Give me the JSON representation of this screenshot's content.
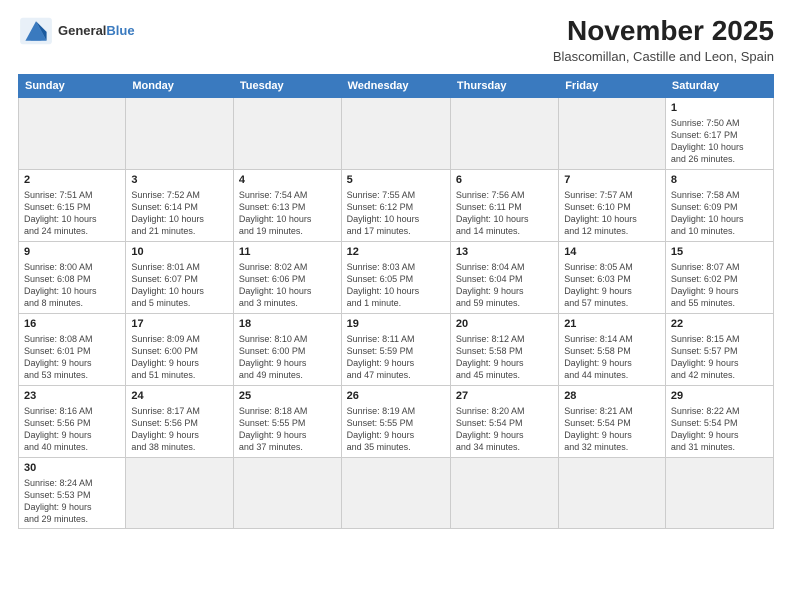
{
  "header": {
    "logo_general": "General",
    "logo_blue": "Blue",
    "month_title": "November 2025",
    "location": "Blascomillan, Castille and Leon, Spain"
  },
  "days_of_week": [
    "Sunday",
    "Monday",
    "Tuesday",
    "Wednesday",
    "Thursday",
    "Friday",
    "Saturday"
  ],
  "weeks": [
    [
      {
        "day": "",
        "info": ""
      },
      {
        "day": "",
        "info": ""
      },
      {
        "day": "",
        "info": ""
      },
      {
        "day": "",
        "info": ""
      },
      {
        "day": "",
        "info": ""
      },
      {
        "day": "",
        "info": ""
      },
      {
        "day": "1",
        "info": "Sunrise: 7:50 AM\nSunset: 6:17 PM\nDaylight: 10 hours\nand 26 minutes."
      }
    ],
    [
      {
        "day": "2",
        "info": "Sunrise: 7:51 AM\nSunset: 6:15 PM\nDaylight: 10 hours\nand 24 minutes."
      },
      {
        "day": "3",
        "info": "Sunrise: 7:52 AM\nSunset: 6:14 PM\nDaylight: 10 hours\nand 21 minutes."
      },
      {
        "day": "4",
        "info": "Sunrise: 7:54 AM\nSunset: 6:13 PM\nDaylight: 10 hours\nand 19 minutes."
      },
      {
        "day": "5",
        "info": "Sunrise: 7:55 AM\nSunset: 6:12 PM\nDaylight: 10 hours\nand 17 minutes."
      },
      {
        "day": "6",
        "info": "Sunrise: 7:56 AM\nSunset: 6:11 PM\nDaylight: 10 hours\nand 14 minutes."
      },
      {
        "day": "7",
        "info": "Sunrise: 7:57 AM\nSunset: 6:10 PM\nDaylight: 10 hours\nand 12 minutes."
      },
      {
        "day": "8",
        "info": "Sunrise: 7:58 AM\nSunset: 6:09 PM\nDaylight: 10 hours\nand 10 minutes."
      }
    ],
    [
      {
        "day": "9",
        "info": "Sunrise: 8:00 AM\nSunset: 6:08 PM\nDaylight: 10 hours\nand 8 minutes."
      },
      {
        "day": "10",
        "info": "Sunrise: 8:01 AM\nSunset: 6:07 PM\nDaylight: 10 hours\nand 5 minutes."
      },
      {
        "day": "11",
        "info": "Sunrise: 8:02 AM\nSunset: 6:06 PM\nDaylight: 10 hours\nand 3 minutes."
      },
      {
        "day": "12",
        "info": "Sunrise: 8:03 AM\nSunset: 6:05 PM\nDaylight: 10 hours\nand 1 minute."
      },
      {
        "day": "13",
        "info": "Sunrise: 8:04 AM\nSunset: 6:04 PM\nDaylight: 9 hours\nand 59 minutes."
      },
      {
        "day": "14",
        "info": "Sunrise: 8:05 AM\nSunset: 6:03 PM\nDaylight: 9 hours\nand 57 minutes."
      },
      {
        "day": "15",
        "info": "Sunrise: 8:07 AM\nSunset: 6:02 PM\nDaylight: 9 hours\nand 55 minutes."
      }
    ],
    [
      {
        "day": "16",
        "info": "Sunrise: 8:08 AM\nSunset: 6:01 PM\nDaylight: 9 hours\nand 53 minutes."
      },
      {
        "day": "17",
        "info": "Sunrise: 8:09 AM\nSunset: 6:00 PM\nDaylight: 9 hours\nand 51 minutes."
      },
      {
        "day": "18",
        "info": "Sunrise: 8:10 AM\nSunset: 6:00 PM\nDaylight: 9 hours\nand 49 minutes."
      },
      {
        "day": "19",
        "info": "Sunrise: 8:11 AM\nSunset: 5:59 PM\nDaylight: 9 hours\nand 47 minutes."
      },
      {
        "day": "20",
        "info": "Sunrise: 8:12 AM\nSunset: 5:58 PM\nDaylight: 9 hours\nand 45 minutes."
      },
      {
        "day": "21",
        "info": "Sunrise: 8:14 AM\nSunset: 5:58 PM\nDaylight: 9 hours\nand 44 minutes."
      },
      {
        "day": "22",
        "info": "Sunrise: 8:15 AM\nSunset: 5:57 PM\nDaylight: 9 hours\nand 42 minutes."
      }
    ],
    [
      {
        "day": "23",
        "info": "Sunrise: 8:16 AM\nSunset: 5:56 PM\nDaylight: 9 hours\nand 40 minutes."
      },
      {
        "day": "24",
        "info": "Sunrise: 8:17 AM\nSunset: 5:56 PM\nDaylight: 9 hours\nand 38 minutes."
      },
      {
        "day": "25",
        "info": "Sunrise: 8:18 AM\nSunset: 5:55 PM\nDaylight: 9 hours\nand 37 minutes."
      },
      {
        "day": "26",
        "info": "Sunrise: 8:19 AM\nSunset: 5:55 PM\nDaylight: 9 hours\nand 35 minutes."
      },
      {
        "day": "27",
        "info": "Sunrise: 8:20 AM\nSunset: 5:54 PM\nDaylight: 9 hours\nand 34 minutes."
      },
      {
        "day": "28",
        "info": "Sunrise: 8:21 AM\nSunset: 5:54 PM\nDaylight: 9 hours\nand 32 minutes."
      },
      {
        "day": "29",
        "info": "Sunrise: 8:22 AM\nSunset: 5:54 PM\nDaylight: 9 hours\nand 31 minutes."
      }
    ],
    [
      {
        "day": "30",
        "info": "Sunrise: 8:24 AM\nSunset: 5:53 PM\nDaylight: 9 hours\nand 29 minutes."
      },
      {
        "day": "",
        "info": ""
      },
      {
        "day": "",
        "info": ""
      },
      {
        "day": "",
        "info": ""
      },
      {
        "day": "",
        "info": ""
      },
      {
        "day": "",
        "info": ""
      },
      {
        "day": "",
        "info": ""
      }
    ]
  ]
}
